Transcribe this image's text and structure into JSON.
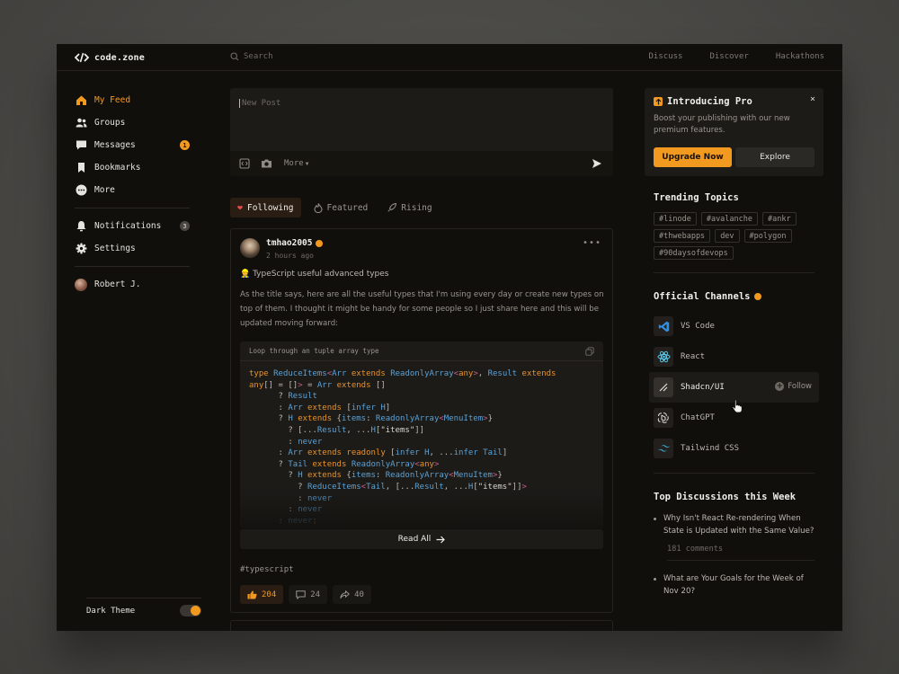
{
  "app": {
    "logo_text": "code.zone"
  },
  "search": {
    "placeholder": "Search"
  },
  "topnav": [
    "Discuss",
    "Discover",
    "Hackathons"
  ],
  "sidebar": {
    "items": [
      {
        "label": "My Feed",
        "icon": "home-icon",
        "active": true
      },
      {
        "label": "Groups",
        "icon": "users-icon"
      },
      {
        "label": "Messages",
        "icon": "message-icon",
        "badge": "1"
      },
      {
        "label": "Bookmarks",
        "icon": "bookmark-icon"
      },
      {
        "label": "More",
        "icon": "more-icon"
      }
    ],
    "secondary": [
      {
        "label": "Notifications",
        "icon": "bell-icon",
        "badge": "3"
      },
      {
        "label": "Settings",
        "icon": "gear-icon"
      }
    ],
    "user": {
      "name": "Robert J."
    },
    "theme_label": "Dark Theme",
    "theme_on": true
  },
  "composer": {
    "placeholder": "New Post",
    "more_label": "More"
  },
  "tabs": [
    {
      "label": "Following",
      "active": true
    },
    {
      "label": "Featured"
    },
    {
      "label": "Rising"
    }
  ],
  "post": {
    "author": "tmhao2005",
    "time": "2 hours ago",
    "title": "👷 TypeScript useful advanced types",
    "body": "As the title says, here are all the useful types that I'm using every day or create new types on top of them. I thought it might be handy for some people so I just share here and this will be updated moving forward:",
    "code_caption": "Loop through an tuple array type",
    "read_all": "Read All",
    "hashtag": "#typescript",
    "likes": "204",
    "comments": "24",
    "shares": "40"
  },
  "promo": {
    "title": "Introducing Pro",
    "close": "×",
    "description": "Boost your publishing with our new premium features.",
    "primary": "Upgrade Now",
    "secondary": "Explore"
  },
  "trending": {
    "title": "Trending Topics",
    "topics": [
      "#linode",
      "#avalanche",
      "#ankr",
      "#thwebapps",
      "dev",
      "#polygon",
      "#90daysofdevops"
    ]
  },
  "channels": {
    "title": "Official Channels",
    "follow_label": "Follow",
    "items": [
      {
        "name": "VS Code",
        "icon": "vscode-icon"
      },
      {
        "name": "React",
        "icon": "react-icon"
      },
      {
        "name": "Shadcn/UI",
        "icon": "shadcn-icon",
        "hover": true
      },
      {
        "name": "ChatGPT",
        "icon": "chatgpt-icon"
      },
      {
        "name": "Tailwind CSS",
        "icon": "tailwind-icon"
      }
    ]
  },
  "discussions": {
    "title": "Top Discussions this Week",
    "items": [
      {
        "title": "Why Isn't React Re-rendering When State is Updated with the Same Value?",
        "meta": "181 comments"
      },
      {
        "title": "What are Your Goals for the Week of Nov 20?"
      }
    ]
  },
  "colors": {
    "accent": "#f29a1f",
    "background": "#110f0c",
    "panel": "#1d1b18"
  }
}
